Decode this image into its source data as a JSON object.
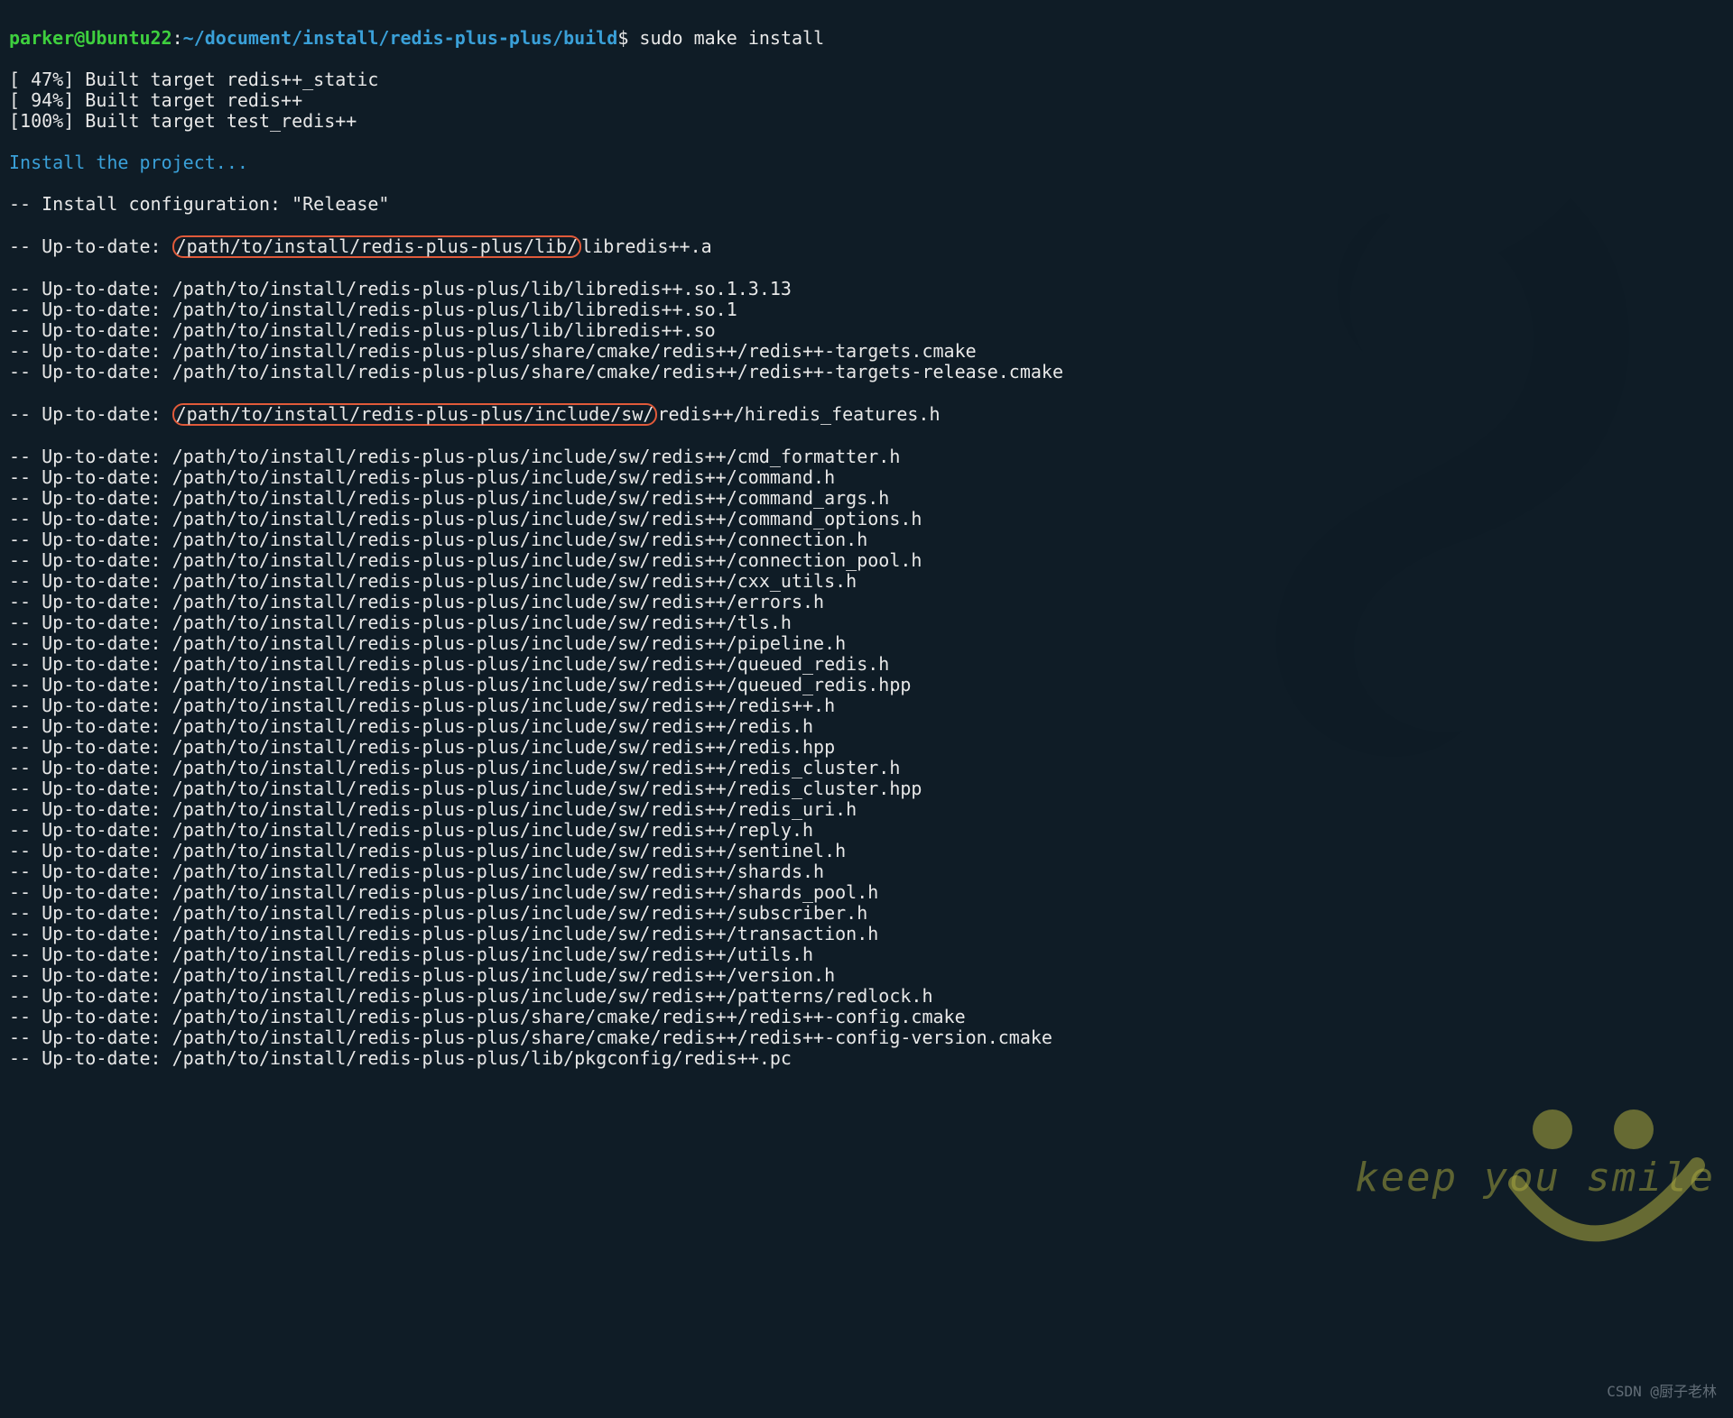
{
  "prompt": {
    "user": "parker",
    "at": "@",
    "host": "Ubuntu22",
    "colon": ":",
    "path": "~/document/install/redis-plus-plus/build",
    "dollar": "$",
    "command": "sudo make install"
  },
  "build_lines": [
    "[ 47%] Built target redis++_static",
    "[ 94%] Built target redis++",
    "[100%] Built target test_redis++"
  ],
  "install_header": "Install the project...",
  "config_line": "-- Install configuration: \"Release\"",
  "highlight1": "/path/to/install/redis-plus-plus/lib/",
  "highlight1_tail": "libredis++.a",
  "highlight2": "/path/to/install/redis-plus-plus/include/sw/",
  "highlight2_tail": "redis++/hiredis_features.h",
  "uptodate_prefix": "-- Up-to-date: ",
  "uptodate_lines_before_h2": [
    "/path/to/install/redis-plus-plus/lib/libredis++.so.1.3.13",
    "/path/to/install/redis-plus-plus/lib/libredis++.so.1",
    "/path/to/install/redis-plus-plus/lib/libredis++.so",
    "/path/to/install/redis-plus-plus/share/cmake/redis++/redis++-targets.cmake",
    "/path/to/install/redis-plus-plus/share/cmake/redis++/redis++-targets-release.cmake"
  ],
  "uptodate_lines_after_h2": [
    "/path/to/install/redis-plus-plus/include/sw/redis++/cmd_formatter.h",
    "/path/to/install/redis-plus-plus/include/sw/redis++/command.h",
    "/path/to/install/redis-plus-plus/include/sw/redis++/command_args.h",
    "/path/to/install/redis-plus-plus/include/sw/redis++/command_options.h",
    "/path/to/install/redis-plus-plus/include/sw/redis++/connection.h",
    "/path/to/install/redis-plus-plus/include/sw/redis++/connection_pool.h",
    "/path/to/install/redis-plus-plus/include/sw/redis++/cxx_utils.h",
    "/path/to/install/redis-plus-plus/include/sw/redis++/errors.h",
    "/path/to/install/redis-plus-plus/include/sw/redis++/tls.h",
    "/path/to/install/redis-plus-plus/include/sw/redis++/pipeline.h",
    "/path/to/install/redis-plus-plus/include/sw/redis++/queued_redis.h",
    "/path/to/install/redis-plus-plus/include/sw/redis++/queued_redis.hpp",
    "/path/to/install/redis-plus-plus/include/sw/redis++/redis++.h",
    "/path/to/install/redis-plus-plus/include/sw/redis++/redis.h",
    "/path/to/install/redis-plus-plus/include/sw/redis++/redis.hpp",
    "/path/to/install/redis-plus-plus/include/sw/redis++/redis_cluster.h",
    "/path/to/install/redis-plus-plus/include/sw/redis++/redis_cluster.hpp",
    "/path/to/install/redis-plus-plus/include/sw/redis++/redis_uri.h",
    "/path/to/install/redis-plus-plus/include/sw/redis++/reply.h",
    "/path/to/install/redis-plus-plus/include/sw/redis++/sentinel.h",
    "/path/to/install/redis-plus-plus/include/sw/redis++/shards.h",
    "/path/to/install/redis-plus-plus/include/sw/redis++/shards_pool.h",
    "/path/to/install/redis-plus-plus/include/sw/redis++/subscriber.h",
    "/path/to/install/redis-plus-plus/include/sw/redis++/transaction.h",
    "/path/to/install/redis-plus-plus/include/sw/redis++/utils.h",
    "/path/to/install/redis-plus-plus/include/sw/redis++/version.h",
    "/path/to/install/redis-plus-plus/include/sw/redis++/patterns/redlock.h",
    "/path/to/install/redis-plus-plus/share/cmake/redis++/redis++-config.cmake",
    "/path/to/install/redis-plus-plus/share/cmake/redis++/redis++-config-version.cmake",
    "/path/to/install/redis-plus-plus/lib/pkgconfig/redis++.pc"
  ],
  "watermark_text": "keep you smile",
  "attribution": "CSDN @厨子老林"
}
